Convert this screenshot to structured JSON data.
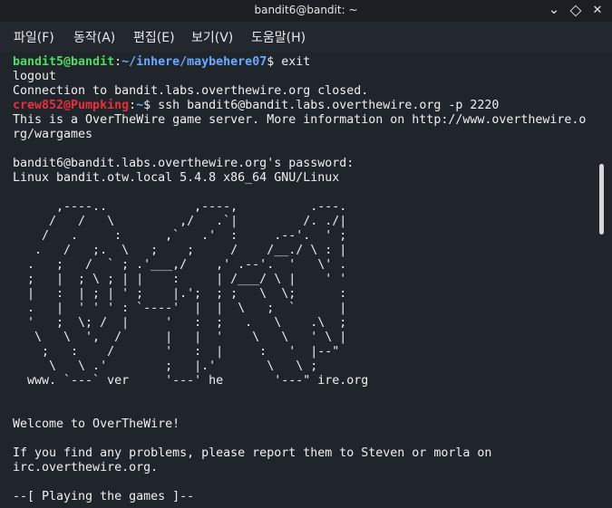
{
  "window": {
    "title": "bandit6@bandit: ~",
    "minimize_glyph": "⌄",
    "close_glyph": "✕"
  },
  "menu": {
    "items": [
      "파일(F)",
      "동작(A)",
      "편집(E)",
      "보기(V)",
      "도움말(H)"
    ]
  },
  "terminal": {
    "line1": {
      "user_host": "bandit5@bandit",
      "colon": ":",
      "path": "~/inhere/maybehere07",
      "symbol": "$ ",
      "command": "exit"
    },
    "line2": "logout",
    "line3": "Connection to bandit.labs.overthewire.org closed.",
    "line4": {
      "user_host": "crew852@Pumpking",
      "colon": ":",
      "path": "~",
      "symbol": "$ ",
      "command": "ssh bandit6@bandit.labs.overthewire.org -p 2220"
    },
    "output": "This is a OverTheWire game server. More information on http://www.overthewire.o\nrg/wargames\n\nbandit6@bandit.labs.overthewire.org's password:\nLinux bandit.otw.local 5.4.8 x86_64 GNU/Linux\n\n      ,----..            ,----,          .---.\n     /   /   \\         ,/   .`|         /. ./|\n    /   .     :      ,`   .'  :     .--'.  ' ;\n   .   /   ;.  \\   ;    ;     /    /__./ \\ : |\n  .   ;   /  ` ; .'___,/    ,' .--'.  '   \\' .\n  ;   |  ; \\ ; | |    :     | /___/ \\ |    ' '\n  |   :  | ; | ' ;    |.';  ; ;   \\  \\;      :\n  .   |  ' ' ' : `----'  |  |  \\   ;  `      |\n  '   ;  \\; /  |     '   :  ;   .   \\    .\\  ;\n   \\   \\  ',  /      |   |  '    \\   \\   ' \\ |\n    ;   :    /       '   :  |     :   '  |--\"\n     \\   \\ .'        ;   |.'       \\   \\ ;\n  www. `---` ver     '---' he       '---\" ire.org\n\n\nWelcome to OverTheWire!\n\nIf you find any problems, please report them to Steven or morla on\nirc.overthewire.org.\n\n--[ Playing the games ]--"
  }
}
